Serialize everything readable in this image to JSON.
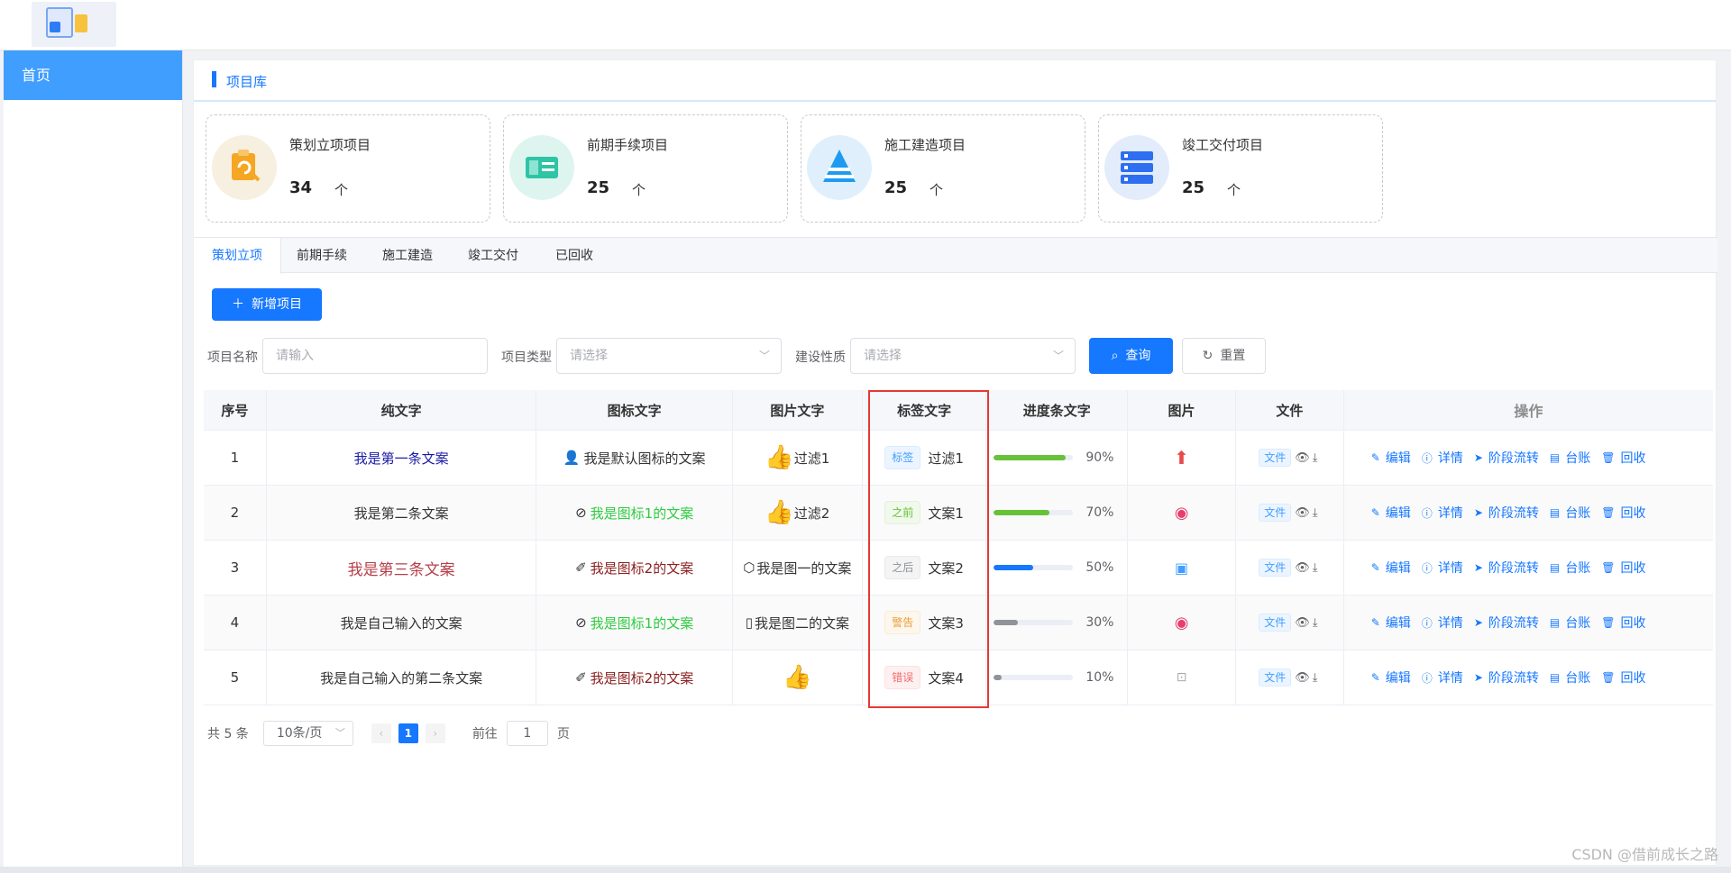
{
  "sidebar": {
    "items": [
      {
        "label": "首页"
      }
    ]
  },
  "header": {
    "title": "项目库"
  },
  "stats": [
    {
      "title": "策划立项项目",
      "count": "34",
      "unit": "个",
      "color": "#f5a623",
      "bg": "#f7efdf",
      "icon": "clipboard-icon"
    },
    {
      "title": "前期手续项目",
      "count": "25",
      "unit": "个",
      "color": "#2ec4a6",
      "bg": "#def5ef",
      "icon": "blueprint-icon"
    },
    {
      "title": "施工建造项目",
      "count": "25",
      "unit": "个",
      "color": "#1e9bf0",
      "bg": "#dff0fc",
      "icon": "construction-icon"
    },
    {
      "title": "竣工交付项目",
      "count": "25",
      "unit": "个",
      "color": "#2d6ff0",
      "bg": "#e3ecfb",
      "icon": "server-icon"
    }
  ],
  "tabs": [
    {
      "label": "策划立项"
    },
    {
      "label": "前期手续"
    },
    {
      "label": "施工建造"
    },
    {
      "label": "竣工交付"
    },
    {
      "label": "已回收"
    }
  ],
  "toolbar": {
    "add_label": "新增项目",
    "query_label": "查询",
    "reset_label": "重置"
  },
  "filters": {
    "name_label": "项目名称",
    "name_placeholder": "请输入",
    "type_label": "项目类型",
    "type_placeholder": "请选择",
    "nature_label": "建设性质",
    "nature_placeholder": "请选择"
  },
  "table": {
    "headers": [
      "序号",
      "纯文字",
      "图标文字",
      "图片文字",
      "标签文字",
      "进度条文字",
      "图片",
      "文件",
      "操作"
    ],
    "ops": [
      "编辑",
      "详情",
      "阶段流转",
      "台账",
      "回收"
    ],
    "file_label": "文件",
    "rows": [
      {
        "index": "1",
        "text": "我是第一条文案",
        "text_color": "#1a1aa6",
        "icon_text": "我是默认图标的文案",
        "icon_color": "#333333",
        "img_text": "过滤1",
        "tag": "标签",
        "tag_text": "过滤1",
        "progress": 90,
        "progress_label": "90%",
        "progress_color": "#67c23a"
      },
      {
        "index": "2",
        "text": "我是第二条文案",
        "text_color": "#333333",
        "icon_text": "我是图标1的文案",
        "icon_color": "#2ecc40",
        "img_text": "过滤2",
        "tag": "之前",
        "tag_text": "文案1",
        "progress": 70,
        "progress_label": "70%",
        "progress_color": "#67c23a"
      },
      {
        "index": "3",
        "text": "我是第三条文案",
        "text_color": "#b5404a",
        "icon_text": "我是图标2的文案",
        "icon_color": "#8b2020",
        "img_text": "我是图一的文案",
        "tag": "之后",
        "tag_text": "文案2",
        "progress": 50,
        "progress_label": "50%",
        "progress_color": "#1677ff"
      },
      {
        "index": "4",
        "text": "我是自己输入的文案",
        "text_color": "#333333",
        "icon_text": "我是图标1的文案",
        "icon_color": "#2ecc40",
        "img_text": "我是图二的文案",
        "tag": "警告",
        "tag_text": "文案3",
        "progress": 30,
        "progress_label": "30%",
        "progress_color": "#909399"
      },
      {
        "index": "5",
        "text": "我是自己输入的第二条文案",
        "text_color": "#333333",
        "icon_text": "我是图标2的文案",
        "icon_color": "#8b2020",
        "img_text": "",
        "tag": "错误",
        "tag_text": "文案4",
        "progress": 10,
        "progress_label": "10%",
        "progress_color": "#909399"
      }
    ]
  },
  "pagination": {
    "total": "共 5 条",
    "size": "10条/页",
    "current": "1",
    "goto_label": "前往",
    "goto_value": "1",
    "page_unit": "页"
  },
  "watermark": "CSDN @借前成长之路"
}
